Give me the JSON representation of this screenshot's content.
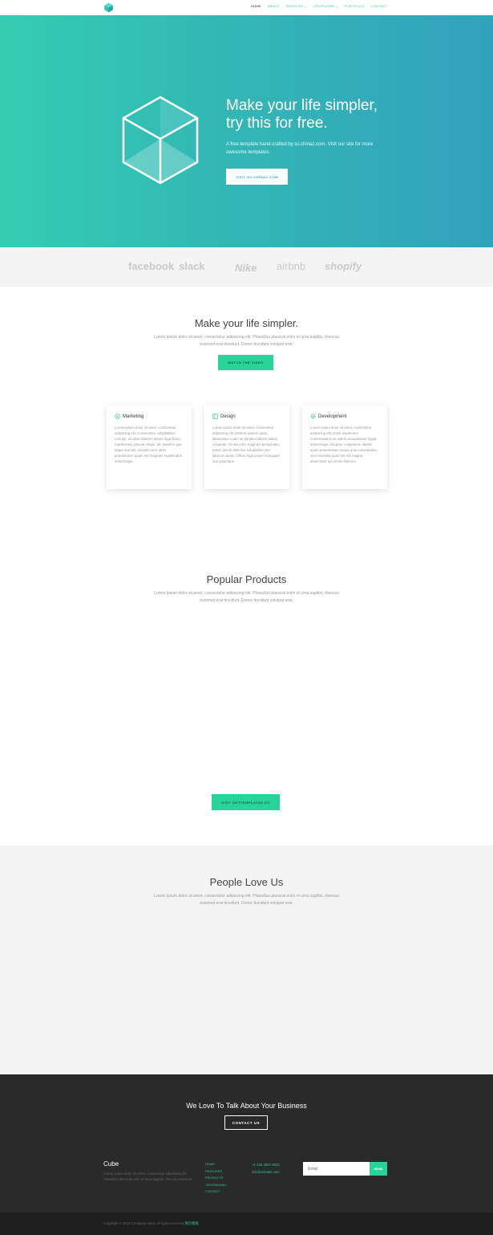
{
  "nav": {
    "items": [
      {
        "label": "HOME"
      },
      {
        "label": "ABOUT"
      },
      {
        "label": "SERVICES ⌄"
      },
      {
        "label": "DROPDOWN ⌄"
      },
      {
        "label": "PORTFOLIO"
      },
      {
        "label": "CONTACT"
      }
    ]
  },
  "hero": {
    "title_line1": "Make your life simpler,",
    "title_line2": "try this for free.",
    "text": "A free template hand-crafted by sc.chinaz.com. Visit our site for more awesome templates.",
    "button": "VISIT SC.CHINAZ.COM"
  },
  "clients": [
    "facebook",
    "slack",
    "Nike",
    "airbnb",
    "shopify"
  ],
  "intro": {
    "title": "Make your life simpler.",
    "text": "Lorem ipsum dolor sit amet, consectetur adipiscing elit. Phasellus placerat enim et urna sagittis, rhoncus euismod erat tincidunt. Donec tincidunt volutpat erat.",
    "button": "WATCH THE VIDEO"
  },
  "cards": [
    {
      "title": "Marketing",
      "text": "Lorem ipsum dolor sit amet, consectetur adipiscing elit. Consectetur voluptatibus corrupti, sit alias dolorem ipsam fuga libero, repellendus placeat neque, ab. Maxime quo atque suscipit. Incidunt vero amet praesentium quam est magnam repellendus doloremque."
    },
    {
      "title": "Design",
      "text": "Lorem ipsum dolor sit amet, consectetur adipiscing elit. Minima quidem quas, laboriosam cuam se pariatur laboris autem, voluptate. Omnis enim magnam perspiciatis, natus, ipsum delectus voluptatum sint laborum quasi. Officia fuga ipsam numquam quo ipsumque."
    },
    {
      "title": "Development",
      "text": "Lorem ipsum dolor sit amet, consectetur adipiscing elit. Dolor asperiores nomenclatura ea autem accusantium fugiat, doloremque voluptas, voluptatem debitis quam praesentium neque quia consequatur, vero expedita quod vel nisi magna aspernatur qui omnis dolorum."
    }
  ],
  "products": {
    "title": "Popular Products",
    "text": "Lorem ipsum dolor sit amet, consectetur adipiscing elit. Phasellus placerat enim et urna sagittis, rhoncus euismod erat tincidunt. Donec tincidunt volutpat erat.",
    "button": "VISIT GETTEMPLATES.CO"
  },
  "testimonials": {
    "title": "People Love Us",
    "text": "Lorem ipsum dolor sit amet, consectetur adipiscing elit. Phasellus placerat enim et urna sagittis, rhoncus euismod erat tincidunt. Donec tincidunt volutpat erat."
  },
  "cta": {
    "title": "We Love To Talk About Your Business",
    "button": "CONTACT US"
  },
  "footer": {
    "brand": "Cube",
    "text": "Lorem ipsum dolor sit amet, consectetur adipiscing elit. Phasellus placerat enim et urna sagittis, rhoncus euismod.",
    "links": [
      "HOME",
      "FEATURES",
      "PRODUCTS",
      "TESTIMONIAL",
      "CONTACT"
    ],
    "phone": "+1 234 4567 8910",
    "email": "info@domain.com",
    "email_placeholder": "Email",
    "send": "SEND",
    "copyright": "Copyright © 2019 Company name All rights reserved ",
    "copyright_link": "网页模板"
  },
  "colors": {
    "accent": "#29d39a",
    "hero_start": "#34cdb3",
    "hero_end": "#32a2bd",
    "footer_bg": "#2a2a2a"
  }
}
